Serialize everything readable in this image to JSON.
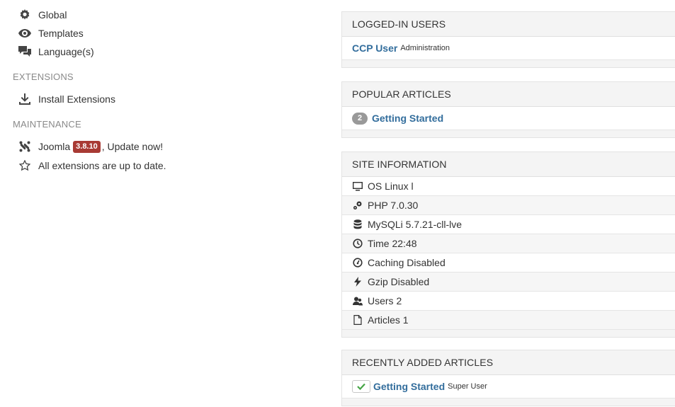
{
  "sidebar": {
    "configuration_items": [
      {
        "label": "Global",
        "icon": "gear-icon"
      },
      {
        "label": "Templates",
        "icon": "eye-icon"
      },
      {
        "label": "Language(s)",
        "icon": "comments-icon"
      }
    ],
    "extensions": {
      "heading": "EXTENSIONS",
      "install_label": "Install Extensions"
    },
    "maintenance": {
      "heading": "MAINTENANCE",
      "joomla_label": "Joomla",
      "version": "3.8.10",
      "update_text": ", Update now!",
      "extensions_status": "All extensions are up to date."
    }
  },
  "logged_in_users": {
    "title": "LOGGED-IN USERS",
    "user_name": "CCP User",
    "user_area": "Administration"
  },
  "popular_articles": {
    "title": "POPULAR ARTICLES",
    "hits": "2",
    "article_title": "Getting Started"
  },
  "site_information": {
    "title": "SITE INFORMATION",
    "rows": [
      {
        "text": "OS Linux l",
        "icon": "monitor-icon"
      },
      {
        "text": "PHP 7.0.30",
        "icon": "php-cogs-icon"
      },
      {
        "text": "MySQLi 5.7.21-cll-lve",
        "icon": "database-icon"
      },
      {
        "text": "Time 22:48",
        "icon": "clock-icon"
      },
      {
        "text": "Caching Disabled",
        "icon": "dashboard-icon"
      },
      {
        "text": "Gzip Disabled",
        "icon": "lightning-icon"
      },
      {
        "text": "Users 2",
        "icon": "users-icon"
      },
      {
        "text": "Articles 1",
        "icon": "file-icon"
      }
    ]
  },
  "recently_added": {
    "title": "RECENTLY ADDED ARTICLES",
    "article_title": "Getting Started",
    "author": "Super User"
  },
  "colors": {
    "link": "#326d9c",
    "version_badge": "#a83a34",
    "section_heading": "#8a8a8a"
  }
}
